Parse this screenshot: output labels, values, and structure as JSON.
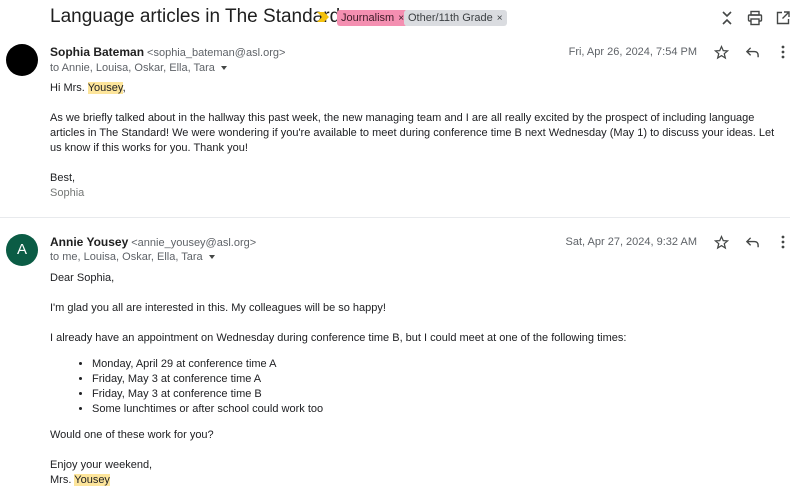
{
  "thread": {
    "subject": "Language articles in The Standard",
    "labels": [
      {
        "text": "Journalism",
        "color": "#f48fb1"
      },
      {
        "text": "Other/11th Grade",
        "color": "#dadce0"
      }
    ],
    "icons": [
      "collapse-all-icon",
      "print-icon",
      "open-in-new-window-icon"
    ]
  },
  "messages": [
    {
      "avatar_color": "#000000",
      "sender_name": "Sophia Bateman",
      "sender_email": "<sophia_bateman@asl.org>",
      "recipients": "to Annie, Louisa, Oskar, Ella, Tara",
      "date": "Fri, Apr 26, 2024, 7:54 PM",
      "greeting_prefix": "Hi Mrs. ",
      "greeting_highlight": "Yousey",
      "greeting_suffix": ",",
      "paragraph": "As we briefly talked about in the hallway this past week, the new managing team and I are all really excited by the prospect of including language articles in The Standard! We were wondering if you're available to meet during conference time B next Wednesday (May 1) to discuss your ideas. Let us know if this works for you. Thank you!",
      "closing": "Best,",
      "signature": "Sophia"
    },
    {
      "avatar_letter": "A",
      "avatar_color": "#0b5c45",
      "sender_name": "Annie Yousey",
      "sender_email": "<annie_yousey@asl.org>",
      "recipients": "to me, Louisa, Oskar, Ella, Tara",
      "date": "Sat, Apr 27, 2024, 9:32 AM",
      "greeting": "Dear Sophia,",
      "line1": "I'm glad you all are interested in this. My colleagues will be so happy!",
      "line2": "I already have an appointment on Wednesday during conference time B, but I could meet at one of the following times:",
      "options": [
        "Monday, April 29 at conference time A",
        "Friday, May 3 at conference time A",
        "Friday, May 3 at conference time B",
        "Some lunchtimes or after school could work too"
      ],
      "question": "Would one of these work for you?",
      "closing": "Enjoy your weekend,",
      "signature_prefix": "Mrs. ",
      "signature_highlight": "Yousey"
    }
  ]
}
